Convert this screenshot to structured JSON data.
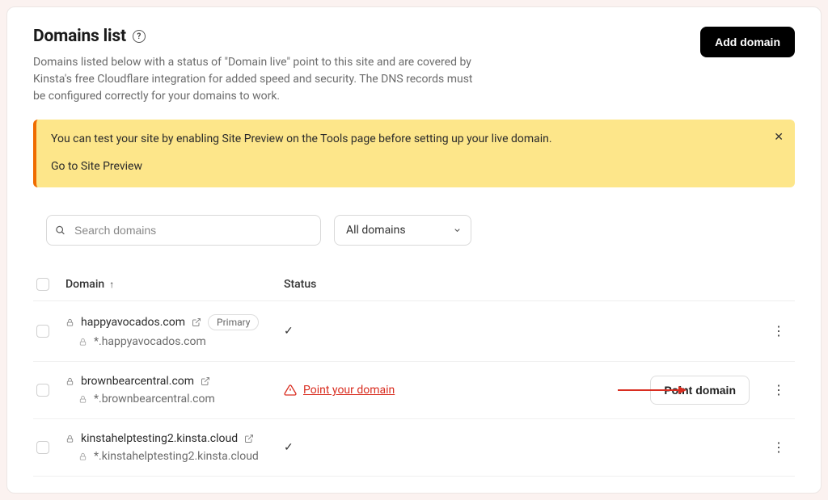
{
  "header": {
    "title": "Domains list",
    "help_glyph": "?",
    "subtitle": "Domains listed below with a status of \"Domain live\" point to this site and are covered by Kinsta's free Cloudflare integration for added speed and security. The DNS records must be configured correctly for your domains to work.",
    "add_button": "Add domain"
  },
  "banner": {
    "message": "You can test your site by enabling Site Preview on the Tools page before setting up your live domain.",
    "link": "Go to Site Preview",
    "close_glyph": "✕"
  },
  "filters": {
    "search_placeholder": "Search domains",
    "dropdown_selected": "All domains"
  },
  "table": {
    "columns": {
      "domain": "Domain",
      "status": "Status",
      "sort_glyph": "↑"
    },
    "rows": [
      {
        "domain": "happyavocados.com",
        "wildcard": "*.happyavocados.com",
        "primary": true,
        "primary_label": "Primary",
        "status": "ok",
        "point_link": null,
        "point_button": null
      },
      {
        "domain": "brownbearcentral.com",
        "wildcard": "*.brownbearcentral.com",
        "primary": false,
        "status": "warn",
        "point_link": "Point your domain",
        "point_button": "Point domain"
      },
      {
        "domain": "kinstahelptesting2.kinsta.cloud",
        "wildcard": "*.kinstahelptesting2.kinsta.cloud",
        "primary": false,
        "status": "ok",
        "point_link": null,
        "point_button": null
      }
    ]
  },
  "icons": {
    "check": "✓",
    "kebab": "⋮"
  }
}
